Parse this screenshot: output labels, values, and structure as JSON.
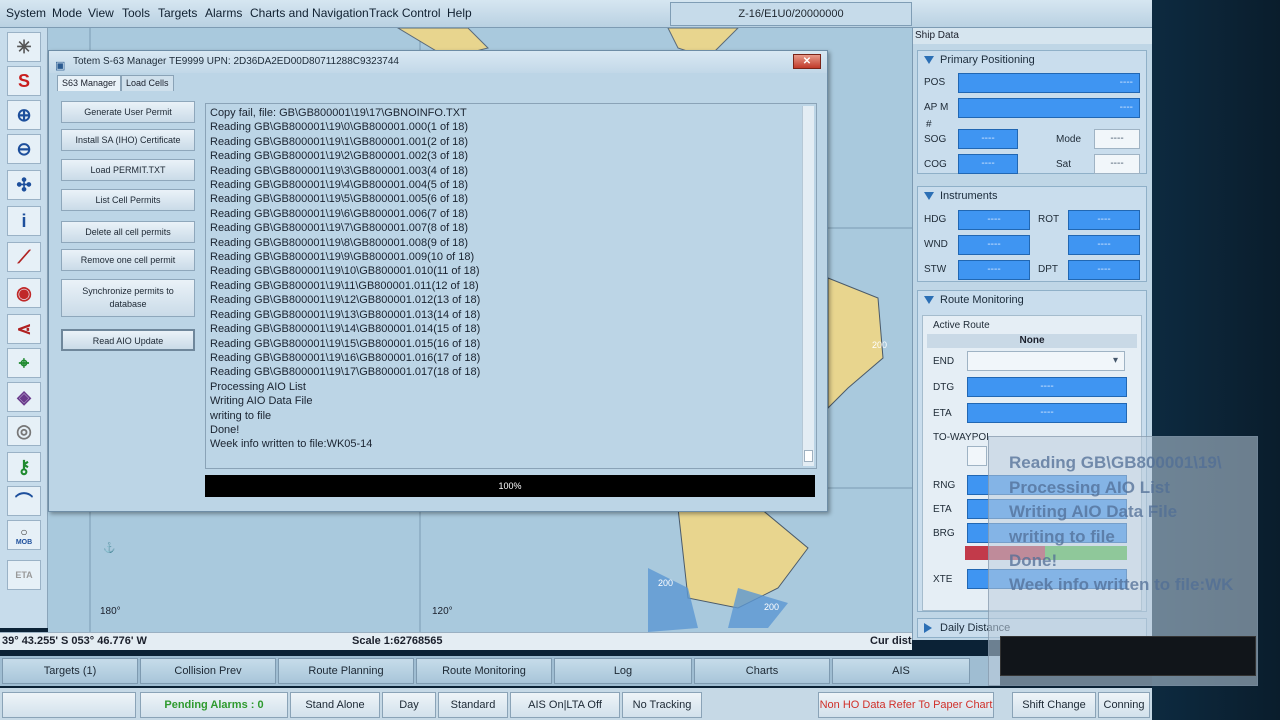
{
  "menu": [
    "System",
    "Mode",
    "View",
    "Tools",
    "Targets",
    "Alarms",
    "Charts and Navigation",
    "Track Control",
    "Help"
  ],
  "top_status": "Z-16/E1U0/20000000",
  "dialog": {
    "title": "Totem S-63 Manager TE9999 UPN: 2D36DA2ED00D80711288C9323744",
    "close_label": "✕",
    "tabs": [
      "S63 Manager",
      "Load Cells"
    ],
    "buttons": [
      "Generate User Permit",
      "Install SA (IHO) Certificate",
      "Load PERMIT.TXT",
      "List Cell Permits",
      "Delete all cell permits",
      "Remove one cell permit",
      "Synchronize permits to database",
      "Read AIO Update"
    ],
    "log": [
      "Copy fail, file: GB\\GB800001\\19\\17\\GBNOINFO.TXT",
      "Reading GB\\GB800001\\19\\0\\GB800001.000(1 of 18)",
      "Reading GB\\GB800001\\19\\1\\GB800001.001(2 of 18)",
      "Reading GB\\GB800001\\19\\2\\GB800001.002(3 of 18)",
      "Reading GB\\GB800001\\19\\3\\GB800001.003(4 of 18)",
      "Reading GB\\GB800001\\19\\4\\GB800001.004(5 of 18)",
      "Reading GB\\GB800001\\19\\5\\GB800001.005(6 of 18)",
      "Reading GB\\GB800001\\19\\6\\GB800001.006(7 of 18)",
      "Reading GB\\GB800001\\19\\7\\GB800001.007(8 of 18)",
      "Reading GB\\GB800001\\19\\8\\GB800001.008(9 of 18)",
      "Reading GB\\GB800001\\19\\9\\GB800001.009(10 of 18)",
      "Reading GB\\GB800001\\19\\10\\GB800001.010(11 of 18)",
      "Reading GB\\GB800001\\19\\11\\GB800001.011(12 of 18)",
      "Reading GB\\GB800001\\19\\12\\GB800001.012(13 of 18)",
      "Reading GB\\GB800001\\19\\13\\GB800001.013(14 of 18)",
      "Reading GB\\GB800001\\19\\14\\GB800001.014(15 of 18)",
      "Reading GB\\GB800001\\19\\15\\GB800001.015(16 of 18)",
      "Reading GB\\GB800001\\19\\16\\GB800001.016(17 of 18)",
      "Reading GB\\GB800001\\19\\17\\GB800001.017(18 of 18)",
      "Processing AIO List",
      "Writing AIO Data File",
      "writing to file",
      "Done!",
      "Week info written to file:WK05-14"
    ],
    "progress_label": "100%",
    "progress_value": 1.0
  },
  "ship_data": {
    "title": "Ship Data",
    "primary": {
      "header": "Primary Positioning",
      "pos_label": "POS",
      "pos_value": "----",
      "apm_label": "AP M",
      "apm_value": "----",
      "hash": "#",
      "sog_label": "SOG",
      "sog": "----",
      "mode_label": "Mode",
      "mode": "----",
      "cog_label": "COG",
      "cog": "----",
      "sat_label": "Sat",
      "sat": "----"
    },
    "instruments": {
      "header": "Instruments",
      "hdg": "HDG",
      "rot": "ROT",
      "wnd": "WND",
      "stw": "STW",
      "dpt": "DPT",
      "dash": "----"
    },
    "route": {
      "header": "Route Monitoring",
      "active_label": "Active Route",
      "active_value": "None",
      "end": "END",
      "dtg": "DTG",
      "eta": "ETA",
      "to_wp": "TO-WAYPOI",
      "rng": "RNG",
      "eta2": "ETA",
      "brg": "BRG",
      "xte": "XTE",
      "dtg_value": "----",
      "eta_value": "----"
    },
    "daily": "Daily Distance"
  },
  "map_labels": {
    "lon1": "180°",
    "lon2": "120°",
    "d200a": "200",
    "d200b": "200",
    "d200c": "200"
  },
  "coords": "39° 43.255' S  053° 46.776' W",
  "scale": "Scale 1:62768565",
  "cur_dist": "Cur dist",
  "nav": [
    "Targets (1)",
    "Collision Prev",
    "Route Planning",
    "Route Monitoring",
    "Log",
    "Charts",
    "AIS"
  ],
  "status": {
    "alarms": "Pending Alarms : 0",
    "stand_alone": "Stand Alone",
    "day": "Day",
    "standard": "Standard",
    "ais": "AIS On|LTA Off",
    "tracking": "No Tracking",
    "ho_warning": "Non HO Data Refer To Paper Chart",
    "shift_change": "Shift Change",
    "conning": "Conning"
  },
  "overlay": [
    "Reading GB\\GB800001\\19\\",
    "Processing AIO List",
    "Writing AIO Data File",
    "writing to file",
    "Done!",
    "Week info written to file:WK"
  ],
  "toolbar_icons": [
    "satellite-icon",
    "s-icon",
    "zoom-in-icon",
    "zoom-out-icon",
    "crosshair-icon",
    "info-icon",
    "line-icon",
    "alarm-icon",
    "route-icon",
    "target-icon",
    "compass-icon",
    "disc-icon",
    "key-icon",
    "wave-icon",
    "mob-icon",
    "eta-icon"
  ],
  "mob_label": "MOB",
  "eta_label": "ETA",
  "colors": {
    "field_blue": "#3f95f2",
    "progress_bg": "#000000",
    "alarm_green": "#2e9a2e",
    "ho_red": "#d0302a"
  }
}
